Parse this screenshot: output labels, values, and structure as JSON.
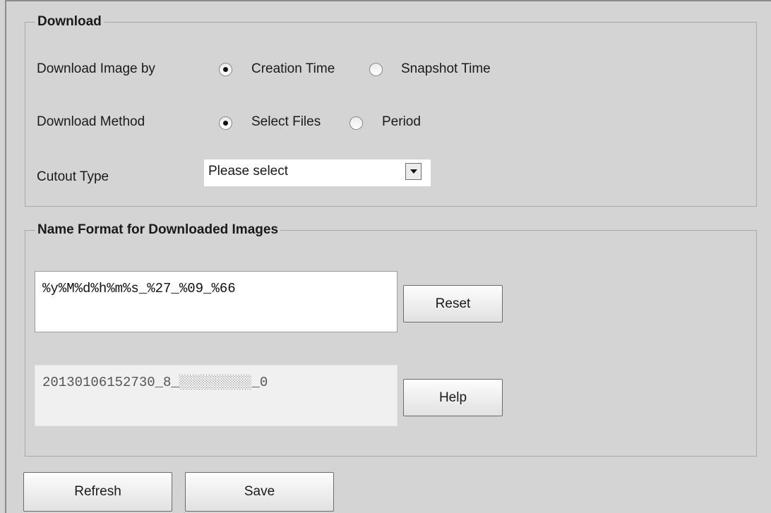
{
  "download_group": {
    "legend": "Download",
    "image_by": {
      "label": "Download Image by",
      "options": [
        {
          "label": "Creation Time",
          "checked": true
        },
        {
          "label": "Snapshot Time",
          "checked": false
        }
      ]
    },
    "method": {
      "label": "Download Method",
      "options": [
        {
          "label": "Select Files",
          "checked": true
        },
        {
          "label": "Period",
          "checked": false
        }
      ]
    },
    "cutout_type": {
      "label": "Cutout Type",
      "selected": "Please select"
    }
  },
  "name_format_group": {
    "legend": "Name Format for Downloaded Images",
    "format_value": "%y%M%d%h%m%s_%27_%09_%66",
    "preview_value": "20130106152730_8_░░░░░░░░░_0",
    "reset_label": "Reset",
    "help_label": "Help"
  },
  "footer": {
    "refresh_label": "Refresh",
    "save_label": "Save"
  }
}
